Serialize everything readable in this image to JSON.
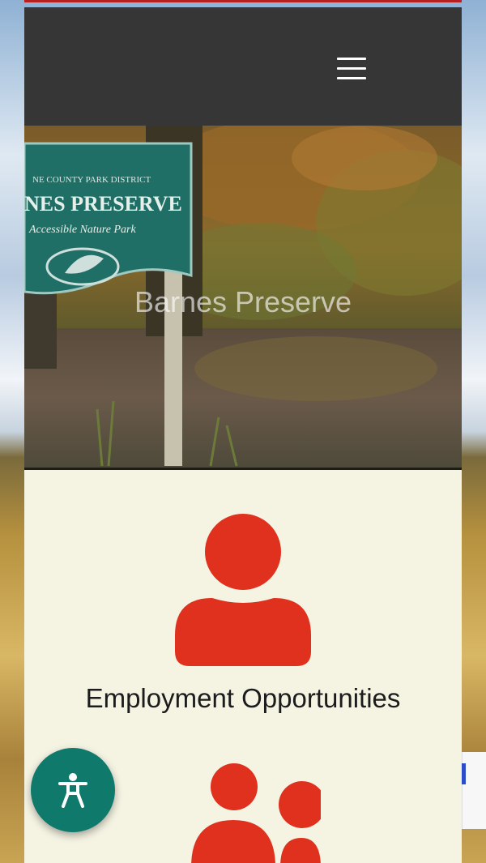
{
  "header": {
    "menu_icon": "hamburger-menu-icon"
  },
  "hero": {
    "title": "Barnes Preserve",
    "sign_lines": [
      "NE COUNTY PARK DISTRICT",
      "NES PRESERVE",
      "Accessible Nature Park"
    ]
  },
  "items": [
    {
      "label": "Employment Opportunities",
      "icon": "person-icon"
    },
    {
      "icon": "group-icon"
    }
  ],
  "accessibility": {
    "icon": "accessibility-icon"
  },
  "colors": {
    "header_bg": "#363636",
    "accent_red": "#e0301e",
    "content_bg": "#f5f4e3",
    "accessibility_bg": "#0f7a6c"
  }
}
